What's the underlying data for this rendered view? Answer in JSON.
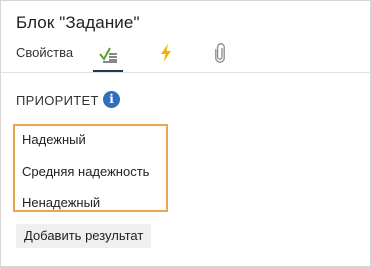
{
  "window": {
    "title": "Блок \"Задание\""
  },
  "tabs": [
    {
      "label": "Свойства",
      "icon": "text-tab",
      "active": false
    },
    {
      "label": "",
      "icon": "checklist-icon",
      "active": true
    },
    {
      "label": "",
      "icon": "lightning-icon",
      "active": false
    },
    {
      "label": "",
      "icon": "paperclip-icon",
      "active": false
    }
  ],
  "priority": {
    "label": "ПРИОРИТЕТ",
    "info_icon": "i",
    "options": [
      "Надежный",
      "Средняя надежность",
      "Ненадежный"
    ]
  },
  "actions": {
    "add_result": "Добавить результат"
  },
  "colors": {
    "active_tab": "#1e3a5f",
    "info_icon": "#2f6fbf",
    "highlight_border": "#e8a552",
    "lightning": "#f0b400",
    "checklist_green": "#5aa02c"
  }
}
